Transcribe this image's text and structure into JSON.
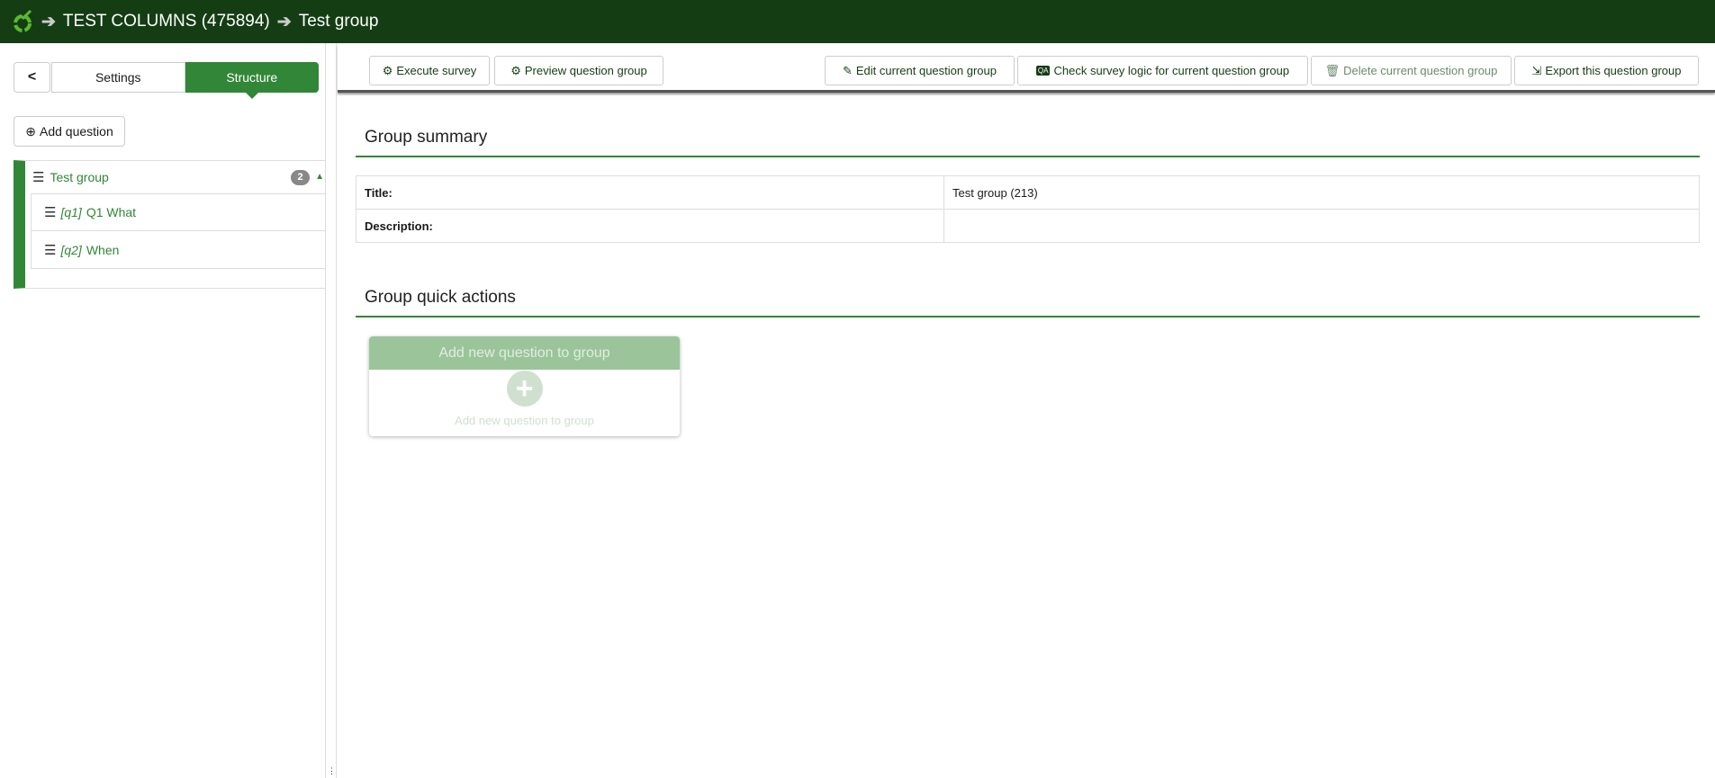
{
  "header": {
    "survey": "TEST COLUMNS (475894)",
    "group": "Test group"
  },
  "sidebar": {
    "settings_tab": "Settings",
    "structure_tab": "Structure",
    "add_question": "Add question",
    "group": {
      "name": "Test group",
      "count": "2"
    },
    "questions": [
      {
        "code": "[q1]",
        "title": "Q1 What"
      },
      {
        "code": "[q2]",
        "title": "When"
      }
    ]
  },
  "toolbar": {
    "execute": "Execute survey",
    "preview": "Preview question group",
    "edit": "Edit current question group",
    "check": "Check survey logic for current question group",
    "delete": "Delete current question group",
    "export": "Export this question group"
  },
  "summary": {
    "heading": "Group summary",
    "rows": [
      {
        "label": "Title:",
        "value": "Test group (213)"
      },
      {
        "label": "Description:",
        "value": ""
      }
    ]
  },
  "quick": {
    "heading": "Group quick actions",
    "card_title": "Add new question to group",
    "card_text": "Add new question to group"
  }
}
